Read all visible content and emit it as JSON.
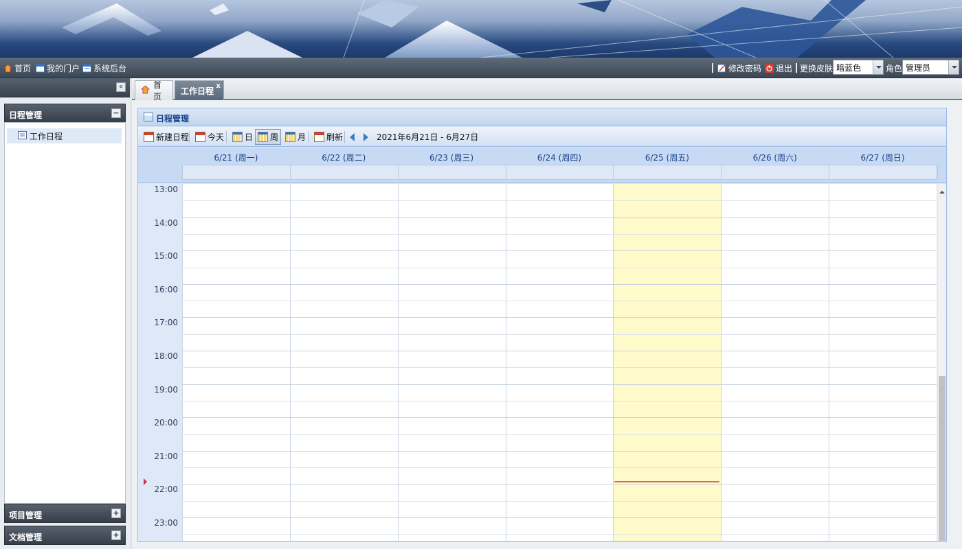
{
  "topbar": {
    "home": "首页",
    "my_portal": "我的门户",
    "admin": "系统后台",
    "change_password": "修改密码",
    "logout": "退出",
    "change_skin_label": "更换皮肤",
    "skin_value": "暗蓝色",
    "role_label": "角色",
    "role_value": "管理员"
  },
  "sidebar": {
    "panels": [
      {
        "title": "日程管理",
        "expanded": true,
        "items": [
          {
            "label": "工作日程"
          }
        ]
      },
      {
        "title": "项目管理",
        "expanded": false
      },
      {
        "title": "文档管理",
        "expanded": false
      }
    ]
  },
  "tabs": [
    {
      "label": "首页",
      "active": false
    },
    {
      "label": "工作日程",
      "active": true,
      "close": "x"
    }
  ],
  "calendar": {
    "panel_title": "日程管理",
    "toolbar": {
      "new_event": "新建日程",
      "today": "今天",
      "day": "日",
      "week": "周",
      "month": "月",
      "refresh": "刷新",
      "date_range": "2021年6月21日 - 6月27日"
    },
    "view": "week",
    "days": [
      "6/21 (周一)",
      "6/22 (周二)",
      "6/23 (周三)",
      "6/24 (周四)",
      "6/25 (周五)",
      "6/26 (周六)",
      "6/27 (周日)"
    ],
    "today_index": 4,
    "hours": [
      "13:00",
      "14:00",
      "15:00",
      "16:00",
      "17:00",
      "18:00",
      "19:00",
      "20:00",
      "21:00",
      "22:00",
      "23:00"
    ],
    "current_time_hour": 21.9
  },
  "colors": {
    "accent": "#15428b",
    "today_bg": "#fffac9",
    "now_line": "#e26a5a"
  }
}
